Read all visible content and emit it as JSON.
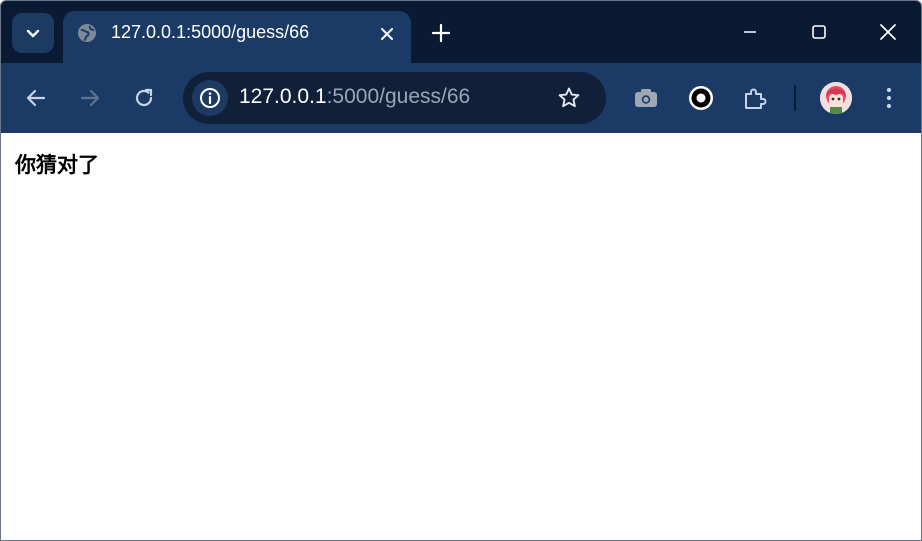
{
  "browser": {
    "tab": {
      "title": "127.0.0.1:5000/guess/66",
      "favicon": "globe-icon"
    },
    "omnibox": {
      "host": "127.0.0.1",
      "path": ":5000/guess/66"
    },
    "colors": {
      "tabstrip": "#0b1a33",
      "toolbar": "#1b3b66",
      "omnibox": "#0f2038",
      "url_muted": "#9aa6b6"
    },
    "icons": [
      "tab-search-icon",
      "close-icon",
      "plus-icon",
      "minimize-icon",
      "maximize-icon",
      "back-arrow-icon",
      "forward-arrow-icon",
      "reload-icon",
      "info-icon",
      "star-icon",
      "camera-icon",
      "ring-icon",
      "puzzle-icon",
      "avatar",
      "kebab-menu-icon"
    ]
  },
  "page": {
    "message": "你猜对了"
  }
}
